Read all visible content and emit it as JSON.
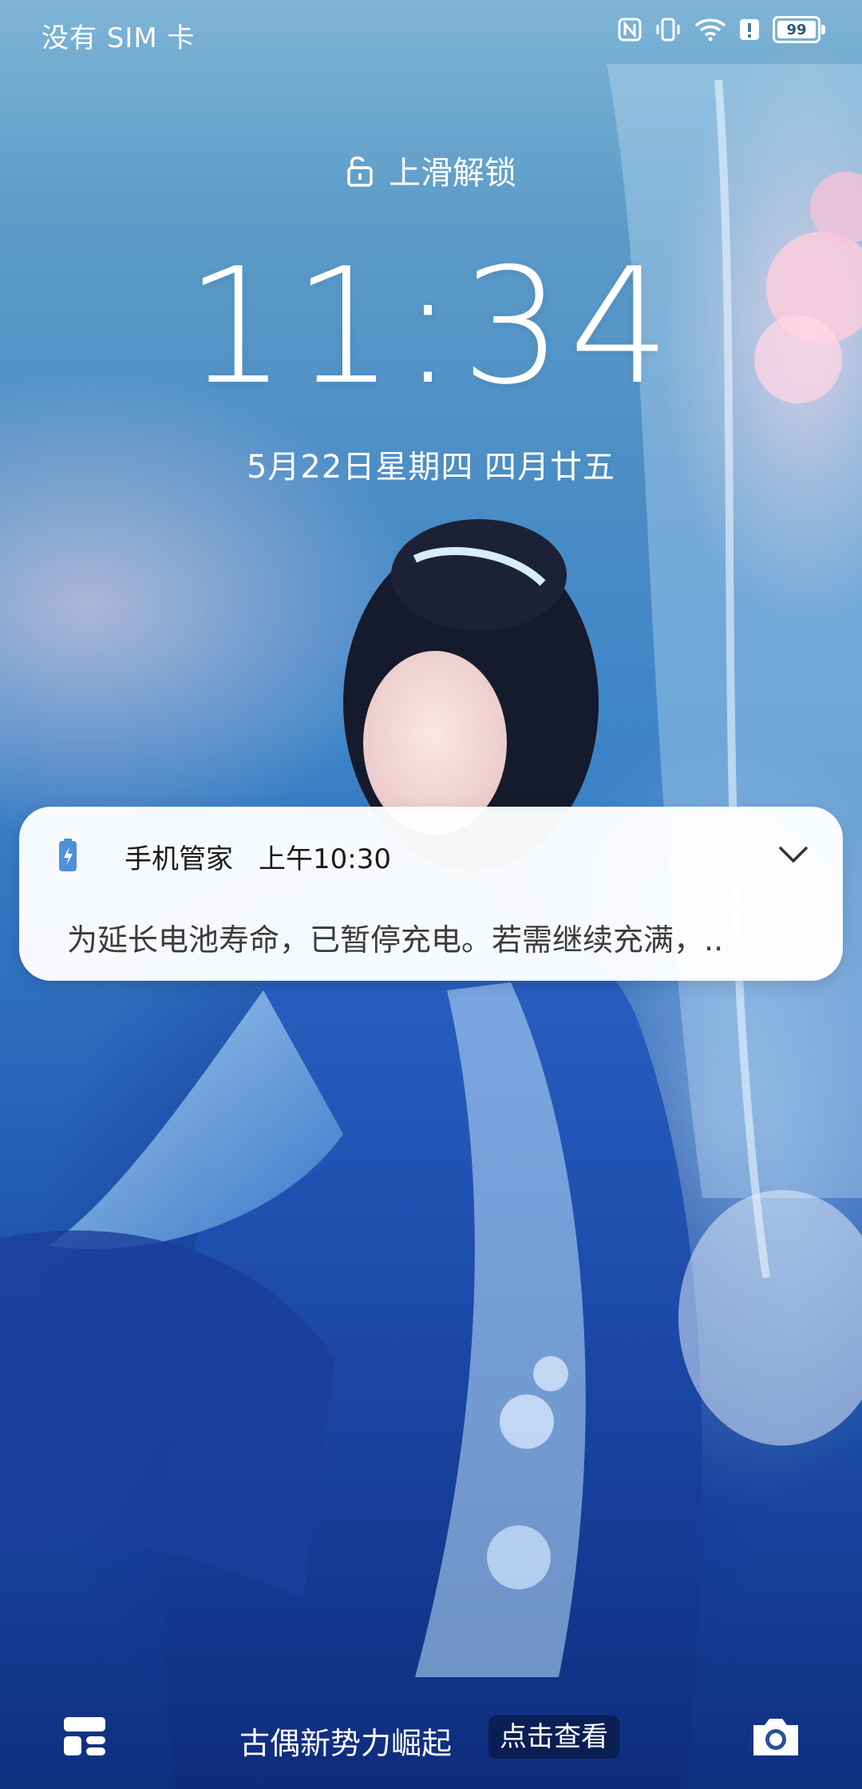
{
  "status_bar": {
    "carrier": "没有 SIM 卡",
    "battery_level": "99",
    "icons": [
      "nfc-icon",
      "vibrate-icon",
      "wifi-icon",
      "alert-icon",
      "battery-icon"
    ]
  },
  "lock": {
    "hint": "上滑解锁",
    "time": "11:34",
    "date": "5月22日星期四  四月廿五"
  },
  "notification": {
    "app": "手机管家",
    "time": "上午10:30",
    "body": "为延长电池寿命，已暂停充电。若需继续充满，.."
  },
  "bottom": {
    "promo_text": "古偶新势力崛起",
    "promo_button": "点击查看"
  }
}
